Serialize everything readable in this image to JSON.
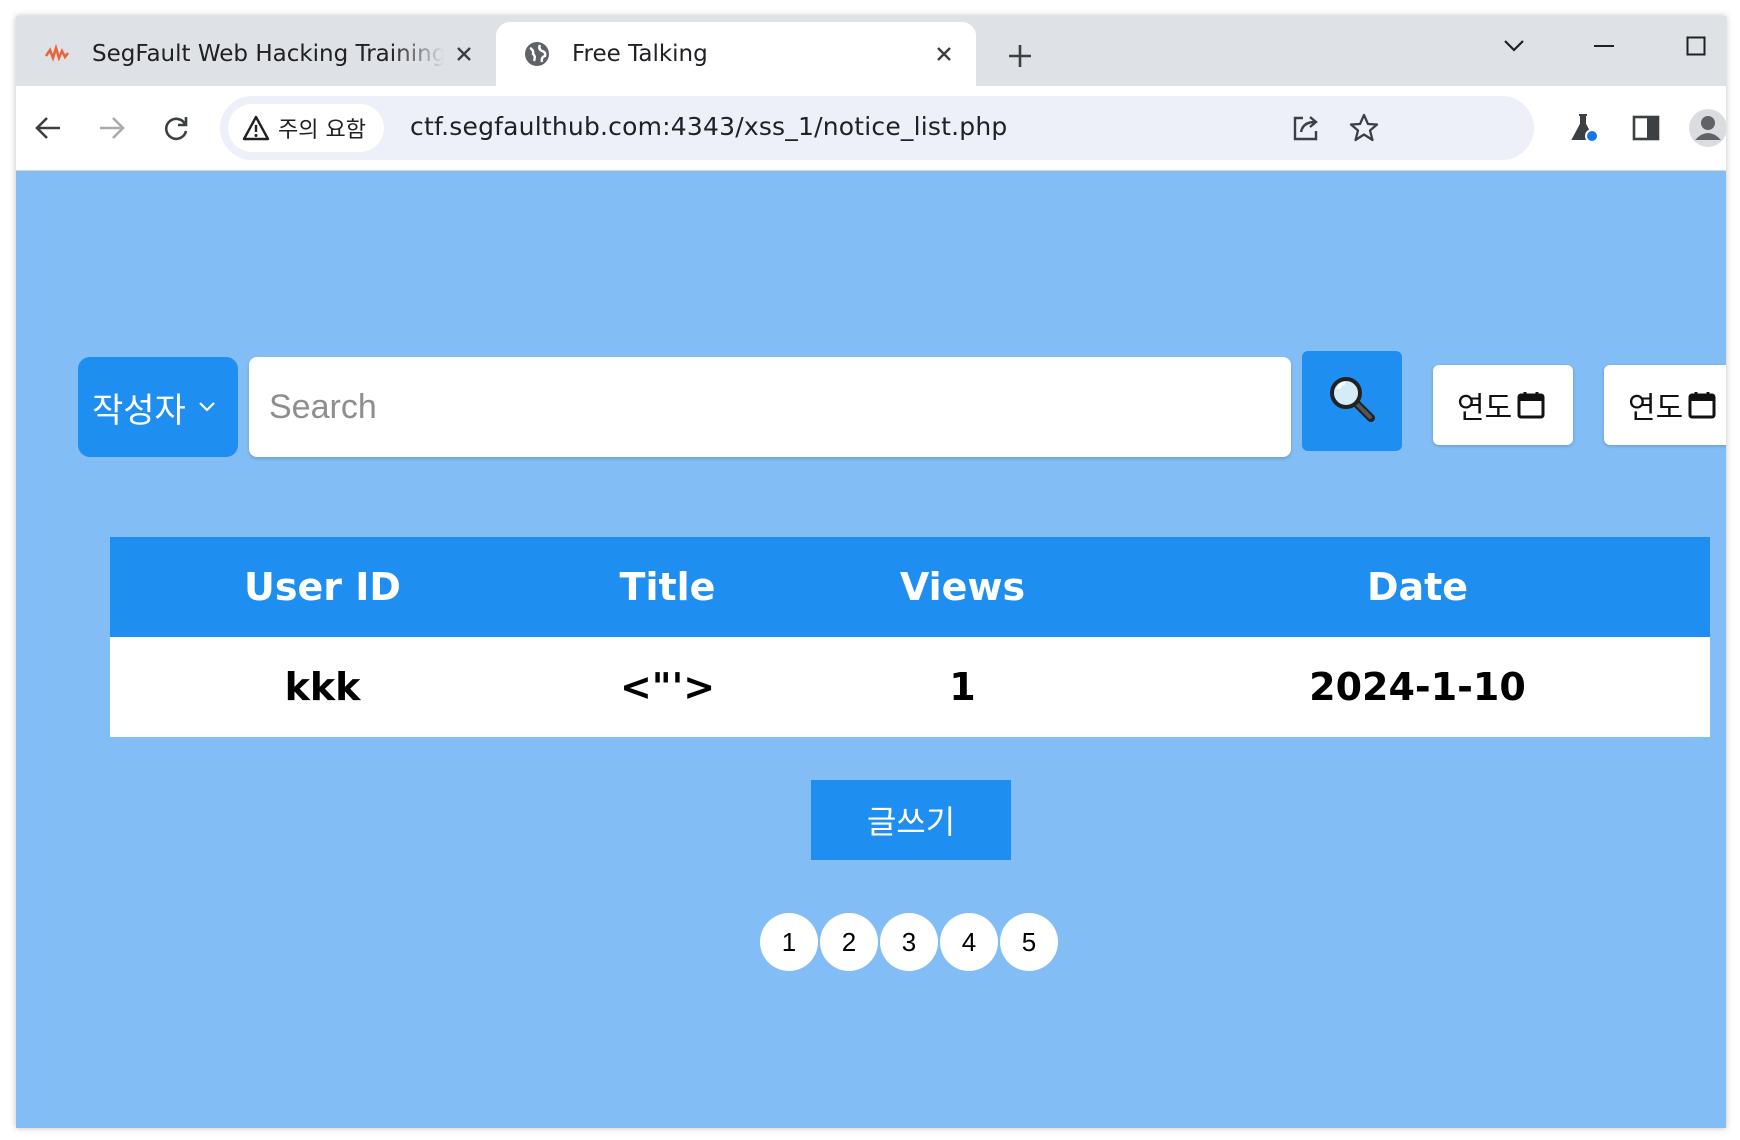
{
  "browser": {
    "tabs": [
      {
        "title": "SegFault Web Hacking Training",
        "active": false,
        "favicon": "segfault-logo-icon"
      },
      {
        "title": "Free Talking",
        "active": true,
        "favicon": "globe-icon"
      }
    ],
    "security_chip": "주의 요함",
    "url": "ctf.segfaulthub.com:4343/xss_1/notice_list.php"
  },
  "search": {
    "field_select": "작성자",
    "placeholder": "Search",
    "date_from_label": "연도",
    "date_to_label": "연도"
  },
  "table": {
    "headers": [
      "User ID",
      "Title",
      "Views",
      "Date"
    ],
    "rows": [
      [
        "kkk",
        "<\"'>",
        "1",
        "2024-1-10"
      ]
    ]
  },
  "write_button": "글쓰기",
  "pagination": [
    "1",
    "2",
    "3",
    "4",
    "5"
  ],
  "colors": {
    "page_bg": "#82bdf5",
    "accent": "#1e8ef0"
  }
}
